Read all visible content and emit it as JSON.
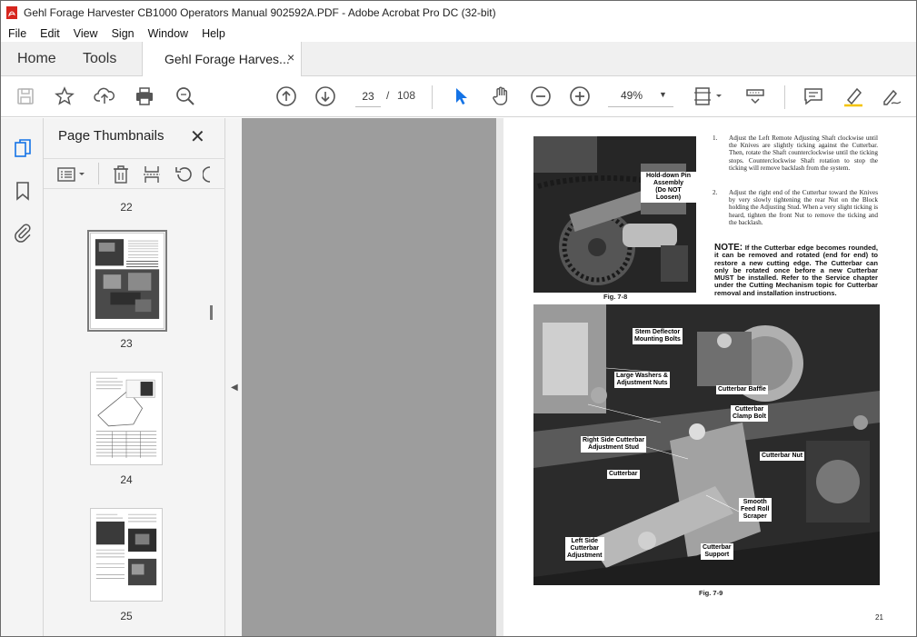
{
  "window": {
    "title": "Gehl Forage Harvester CB1000 Operators Manual 902592A.PDF - Adobe Acrobat Pro DC (32-bit)"
  },
  "menu": [
    "File",
    "Edit",
    "View",
    "Sign",
    "Window",
    "Help"
  ],
  "tabs": {
    "home": "Home",
    "tools": "Tools",
    "document": "Gehl Forage Harves...",
    "close": "×"
  },
  "toolbar": {
    "current_page": "23",
    "page_separator": "/",
    "total_pages": "108",
    "zoom": "49%",
    "icons": [
      "save-icon",
      "bookmark-star-icon",
      "upload-icon",
      "print-icon",
      "find-icon",
      "prev-page-icon",
      "next-page-icon",
      "select-pointer-icon",
      "hand-icon",
      "zoom-out-icon",
      "zoom-in-icon",
      "fit-page-icon",
      "scroll-mode-icon",
      "comment-icon",
      "highlight-icon",
      "sign-icon"
    ],
    "accent": "#1473e6"
  },
  "sidebar": {
    "title": "Page Thumbnails",
    "close": "✕",
    "thumbnails": [
      {
        "label": "22"
      },
      {
        "label": "23",
        "selected": true
      },
      {
        "label": "24"
      },
      {
        "label": "25"
      }
    ]
  },
  "document": {
    "callouts": {
      "hold_down_pin": "Hold-down Pin\nAssembly\n(Do NOT Loosen)",
      "stem_deflector": "Stem Deflector\nMounting Bolts",
      "large_washers": "Large Washers &\nAdjustment Nuts",
      "cutterbar_baffle": "Cutterbar Baffle",
      "cutterbar_clamp": "Cutterbar\nClamp Bolt",
      "right_side_stud": "Right Side Cutterbar\nAdjustment Stud",
      "cutterbar_nut": "Cutterbar Nut",
      "cutterbar": "Cutterbar",
      "smooth_feed_roll": "Smooth\nFeed Roll\nScraper",
      "left_side_adj": "Left Side\nCutterbar\nAdjustment",
      "cutterbar_support": "Cutterbar\nSupport"
    },
    "fig_top": "Fig. 7-8",
    "fig_bottom": "Fig. 7-9",
    "step1_num": "1.",
    "step1": "Adjust the Left Remote Adjusting Shaft clockwise until the Knives are slightly ticking against the Cutterbar. Then, rotate the Shaft counterclockwise until the ticking stops. Counterclockwise Shaft rotation to stop the ticking will remove backlash from the system.",
    "step2_num": "2.",
    "step2": "Adjust the right end of the Cutterbar toward the Knives by very slowly tightening the rear Nut on the Block holding the Adjusting Stud. When a very slight ticking is heard, tighten the front Nut to remove the ticking and the backlash.",
    "note_label": "NOTE:",
    "note": "If the Cutterbar edge becomes rounded, it can be removed and rotated (end for end) to restore a new cutting edge. The Cutterbar can only be rotated once before a new Cutterbar MUST be installed. Refer to the Service chapter under the Cutting Mechanism topic for Cutterbar removal and installation instructions.",
    "page_number": "21"
  }
}
